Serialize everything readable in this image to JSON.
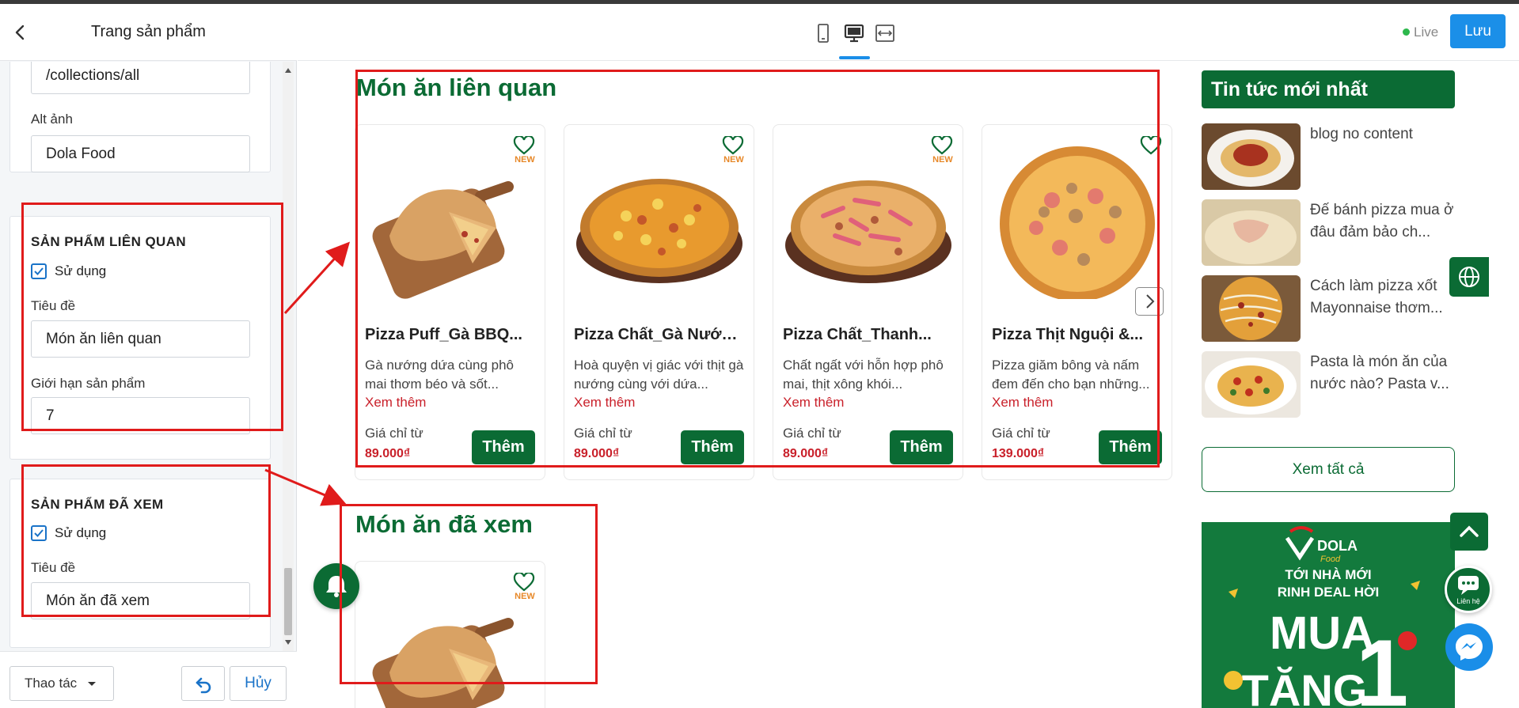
{
  "left_panel": {
    "title": "Trang sản phẩm",
    "link_value": "/collections/all",
    "alt_label": "Alt ảnh",
    "alt_value": "Dola Food",
    "related": {
      "section_title": "SẢN PHẨM LIÊN QUAN",
      "use_label": "Sử dụng",
      "title_label": "Tiêu đề",
      "title_value": "Món ăn liên quan",
      "limit_label": "Giới hạn sản phẩm",
      "limit_value": "7"
    },
    "viewed": {
      "section_title": "SẢN PHẨM ĐÃ XEM",
      "use_label": "Sử dụng",
      "title_label": "Tiêu đề",
      "title_value": "Món ăn đã xem"
    },
    "footer": {
      "action_label": "Thao tác",
      "cancel_label": "Hủy"
    }
  },
  "topbar": {
    "devices": [
      "mobile-icon",
      "desktop-icon",
      "fullwidth-icon"
    ],
    "active_device": "desktop-icon",
    "live_label": "Live",
    "save_label": "Lưu",
    "accent": "#1b8fe8"
  },
  "preview": {
    "related_title": "Món ăn liên quan",
    "viewed_title": "Món ăn đã xem",
    "new_badge": "NEW",
    "products": [
      {
        "name": "Pizza Puff_Gà BBQ...",
        "desc": "Gà nướng dứa cùng phô mai thơm béo và sốt...",
        "more": "Xem thêm",
        "price_label": "Giá chỉ từ",
        "price": "89.000₫",
        "add": "Thêm",
        "badge": true
      },
      {
        "name": "Pizza Chất_Gà Nướn...",
        "desc": "Hoà quyện vị giác với thịt gà nướng cùng với dứa...",
        "more": "Xem thêm",
        "price_label": "Giá chỉ từ",
        "price": "89.000₫",
        "add": "Thêm",
        "badge": true
      },
      {
        "name": "Pizza Chất_Thanh...",
        "desc": "Chất ngất với hỗn hợp phô mai, thịt xông khói...",
        "more": "Xem thêm",
        "price_label": "Giá chỉ từ",
        "price": "89.000₫",
        "add": "Thêm",
        "badge": true
      },
      {
        "name": "Pizza Thịt Nguội &...",
        "desc": "Pizza giăm bông và nấm đem đến cho bạn những...",
        "more": "Xem thêm",
        "price_label": "Giá chỉ từ",
        "price": "139.000₫",
        "add": "Thêm",
        "badge": false
      }
    ],
    "news": {
      "heading": "Tin tức mới nhất",
      "items": [
        "blog no content",
        "Đế bánh pizza mua ở đâu đảm bảo ch...",
        "Cách làm pizza xốt Mayonnaise thơm...",
        "Pasta là món ăn của nước nào? Pasta v..."
      ],
      "see_all": "Xem tất cả"
    },
    "banner": {
      "brand": "DOLA",
      "brand_sub": "Food",
      "line1": "TỚI NHÀ MỚI",
      "line2": "RINH DEAL HỜI",
      "big1": "MUA",
      "big2": "TẶNG",
      "big_num": "1"
    },
    "contact_label": "Liên hệ",
    "brand_green": "#0b6b34",
    "price_red": "#c9202a"
  }
}
